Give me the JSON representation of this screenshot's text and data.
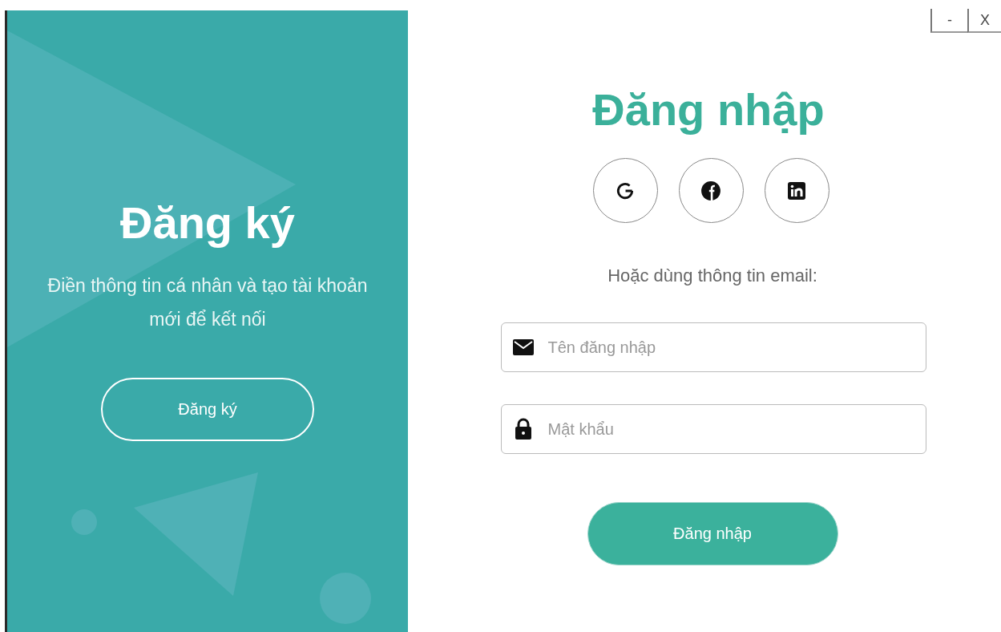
{
  "window_controls": [
    {
      "label": "-"
    },
    {
      "label": "X"
    }
  ],
  "signup_panel": {
    "title": "Đăng ký",
    "message": "Điền thông tin cá nhân và tạo tài khoản mới để kết nối",
    "button": "Đăng ký"
  },
  "login": {
    "title": "Đăng nhập",
    "social": [
      {
        "kind": "google"
      },
      {
        "kind": "facebook"
      },
      {
        "kind": "linkedin"
      }
    ],
    "divider_text": "Hoặc dùng thông tin email:",
    "fields": [
      {
        "kind": "email",
        "placeholder": "Tên đăng nhập"
      },
      {
        "kind": "password",
        "placeholder": "Mật khẩu"
      }
    ],
    "button": "Đăng nhập"
  }
}
